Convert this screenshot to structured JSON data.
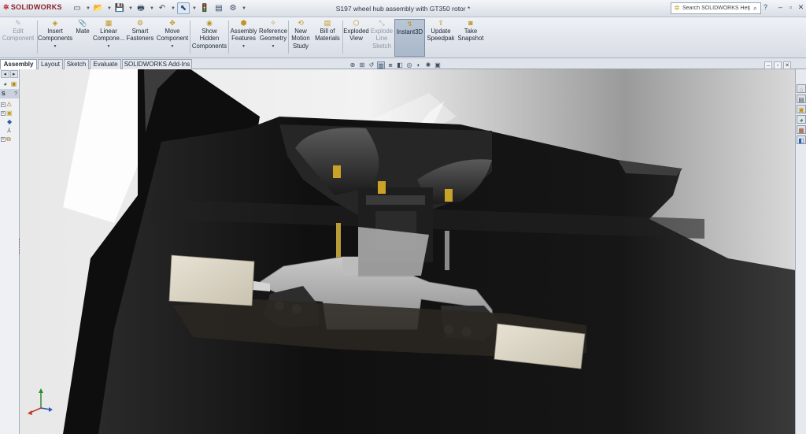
{
  "app": {
    "logo_text": "SOLIDWORKS",
    "document_title": "S197 wheel hub assembly with GT350 rotor *"
  },
  "quick_access": {
    "buttons": [
      {
        "name": "new-document",
        "glyph": "▭"
      },
      {
        "name": "open-document",
        "glyph": "📂"
      },
      {
        "name": "save",
        "glyph": "💾"
      },
      {
        "name": "print",
        "glyph": "🖶"
      },
      {
        "name": "undo",
        "glyph": "↶"
      },
      {
        "name": "select",
        "glyph": "⬉"
      },
      {
        "name": "rebuild",
        "glyph": "🚦"
      },
      {
        "name": "file-properties",
        "glyph": "▤"
      },
      {
        "name": "options",
        "glyph": "⚙"
      }
    ]
  },
  "search": {
    "placeholder": "Search SOLIDWORKS Help",
    "icon": "solidworks-icon"
  },
  "window_controls": {
    "help": "?",
    "minimize": "–",
    "restore": "▫",
    "close": "✕"
  },
  "ribbon": {
    "commands": [
      {
        "id": "edit-component",
        "label": "Edit\nComponent",
        "icon": "edit-component-icon",
        "disabled": true
      },
      {
        "id": "insert-components",
        "label": "Insert\nComponents",
        "icon": "insert-components-icon",
        "dropdown": true
      },
      {
        "id": "mate",
        "label": "Mate",
        "icon": "paperclip-icon"
      },
      {
        "id": "linear-component",
        "label": "Linear\nCompone...",
        "icon": "linear-pattern-icon",
        "dropdown": true
      },
      {
        "id": "smart-fasteners",
        "label": "Smart\nFasteners",
        "icon": "fastener-icon"
      },
      {
        "id": "move-component",
        "label": "Move\nComponent",
        "icon": "move-icon",
        "dropdown": true
      },
      {
        "id": "show-hidden",
        "label": "Show\nHidden\nComponents",
        "icon": "eye-icon"
      },
      {
        "id": "assembly-features",
        "label": "Assembly\nFeatures",
        "icon": "assembly-features-icon",
        "dropdown": true
      },
      {
        "id": "reference-geometry",
        "label": "Reference\nGeometry",
        "icon": "reference-geometry-icon",
        "dropdown": true
      },
      {
        "id": "new-motion-study",
        "label": "New\nMotion\nStudy",
        "icon": "motion-study-icon"
      },
      {
        "id": "bill-of-materials",
        "label": "Bill of\nMaterials",
        "icon": "bom-icon"
      },
      {
        "id": "exploded-view",
        "label": "Exploded\nView",
        "icon": "exploded-view-icon"
      },
      {
        "id": "explode-line-sketch",
        "label": "Explode\nLine\nSketch",
        "icon": "explode-line-icon",
        "disabled": true
      },
      {
        "id": "instant3d",
        "label": "Instant3D",
        "icon": "instant3d-icon",
        "active": true
      },
      {
        "id": "update-speedpak",
        "label": "Update\nSpeedpak",
        "icon": "speedpak-icon"
      },
      {
        "id": "take-snapshot",
        "label": "Take\nSnapshot",
        "icon": "camera-icon"
      }
    ]
  },
  "tabs": [
    {
      "label": "Assembly",
      "active": true
    },
    {
      "label": "Layout"
    },
    {
      "label": "Sketch"
    },
    {
      "label": "Evaluate"
    },
    {
      "label": "SOLIDWORKS Add-Ins"
    }
  ],
  "left_pane": {
    "header": "S",
    "help": "?"
  },
  "heads_up_toolbar": [
    "zoom-to-fit-icon",
    "zoom-area-icon",
    "previous-view-icon",
    "section-view-icon",
    "view-orientation-icon",
    "display-style-icon",
    "hide-show-icon",
    "edit-appearance-icon",
    "apply-scene-icon",
    "view-settings-icon"
  ],
  "colors": {
    "accent": "#c09520",
    "ribbon_bg": "#d8dde5",
    "active_command": "#b9c6d6",
    "model_dark": "#141414",
    "aluminum": "#a9a9a9",
    "pad": "#d8d2c2"
  }
}
